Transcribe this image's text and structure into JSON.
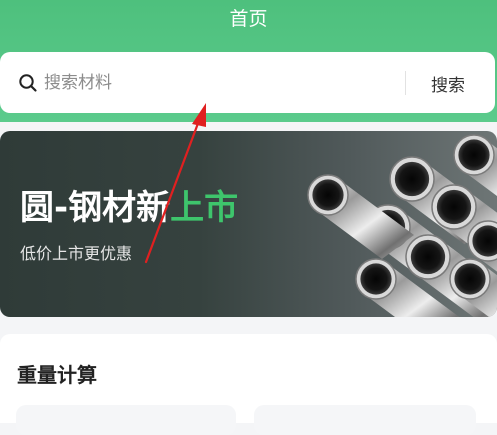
{
  "header": {
    "title": "首页"
  },
  "search": {
    "placeholder": "搜索材料",
    "value": "",
    "button_label": "搜索"
  },
  "banner": {
    "title_main": "圆-钢材新",
    "title_accent": "上市",
    "subtitle": "低价上市更优惠",
    "accent_color": "#3ec56c"
  },
  "section": {
    "title": "重量计算"
  },
  "colors": {
    "header_green": "#4ec07d",
    "annotation_arrow": "#e02020"
  },
  "icons": {
    "search": "search-icon",
    "banner_image": "steel-pipes-image"
  }
}
